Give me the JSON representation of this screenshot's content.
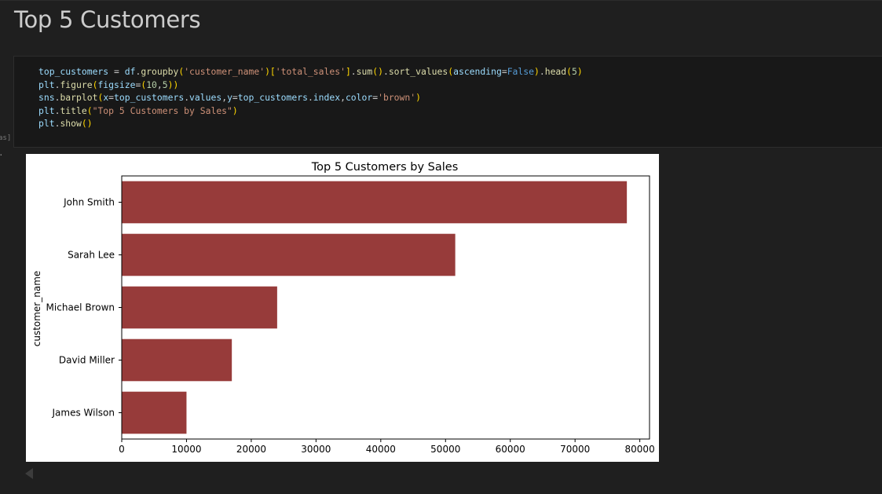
{
  "notebook": {
    "heading": "Top 5 Customers",
    "execution_count": "as]",
    "output_marker": ".",
    "code_lines": [
      [
        [
          "v",
          "top_customers"
        ],
        [
          "t",
          " = "
        ],
        [
          "v",
          "df"
        ],
        [
          "t",
          "."
        ],
        [
          "f",
          "groupby"
        ],
        [
          "p",
          "("
        ],
        [
          "s",
          "'customer_name'"
        ],
        [
          "p",
          ")"
        ],
        [
          "p",
          "["
        ],
        [
          "s",
          "'total_sales'"
        ],
        [
          "p",
          "]"
        ],
        [
          "t",
          "."
        ],
        [
          "f",
          "sum"
        ],
        [
          "p",
          "()"
        ],
        [
          "t",
          "."
        ],
        [
          "f",
          "sort_values"
        ],
        [
          "p",
          "("
        ],
        [
          "v",
          "ascending"
        ],
        [
          "t",
          "="
        ],
        [
          "k",
          "False"
        ],
        [
          "p",
          ")"
        ],
        [
          "t",
          "."
        ],
        [
          "f",
          "head"
        ],
        [
          "p",
          "("
        ],
        [
          "n",
          "5"
        ],
        [
          "p",
          ")"
        ]
      ],
      [
        [
          "v",
          "plt"
        ],
        [
          "t",
          "."
        ],
        [
          "f",
          "figure"
        ],
        [
          "p",
          "("
        ],
        [
          "v",
          "figsize"
        ],
        [
          "t",
          "="
        ],
        [
          "p",
          "("
        ],
        [
          "n",
          "10"
        ],
        [
          "t",
          ","
        ],
        [
          "n",
          "5"
        ],
        [
          "p",
          "))"
        ]
      ],
      [
        [
          "v",
          "sns"
        ],
        [
          "t",
          "."
        ],
        [
          "f",
          "barplot"
        ],
        [
          "p",
          "("
        ],
        [
          "v",
          "x"
        ],
        [
          "t",
          "="
        ],
        [
          "v",
          "top_customers"
        ],
        [
          "t",
          "."
        ],
        [
          "v",
          "values"
        ],
        [
          "t",
          ","
        ],
        [
          "v",
          "y"
        ],
        [
          "t",
          "="
        ],
        [
          "v",
          "top_customers"
        ],
        [
          "t",
          "."
        ],
        [
          "v",
          "index"
        ],
        [
          "t",
          ","
        ],
        [
          "v",
          "color"
        ],
        [
          "t",
          "="
        ],
        [
          "s",
          "'brown'"
        ],
        [
          "p",
          ")"
        ]
      ],
      [
        [
          "v",
          "plt"
        ],
        [
          "t",
          "."
        ],
        [
          "f",
          "title"
        ],
        [
          "p",
          "("
        ],
        [
          "s",
          "\"Top 5 Customers by Sales\""
        ],
        [
          "p",
          ")"
        ]
      ],
      [
        [
          "v",
          "plt"
        ],
        [
          "t",
          "."
        ],
        [
          "f",
          "show"
        ],
        [
          "p",
          "()"
        ]
      ]
    ]
  },
  "colors": {
    "background": "#1f1f1f",
    "bar": "#973b3a"
  },
  "chart_data": {
    "type": "bar",
    "orientation": "horizontal",
    "title": "Top 5 Customers by Sales",
    "xlabel": "",
    "ylabel": "customer_name",
    "categories": [
      "John Smith",
      "Sarah Lee",
      "Michael Brown",
      "David Miller",
      "James Wilson"
    ],
    "values": [
      78000,
      51500,
      24000,
      17000,
      10000
    ],
    "xlim": [
      0,
      81500
    ],
    "xticks": [
      0,
      10000,
      20000,
      30000,
      40000,
      50000,
      60000,
      70000,
      80000
    ],
    "xtick_labels": [
      "0",
      "10000",
      "20000",
      "30000",
      "40000",
      "50000",
      "60000",
      "70000",
      "80000"
    ],
    "grid": false,
    "legend": "none"
  }
}
